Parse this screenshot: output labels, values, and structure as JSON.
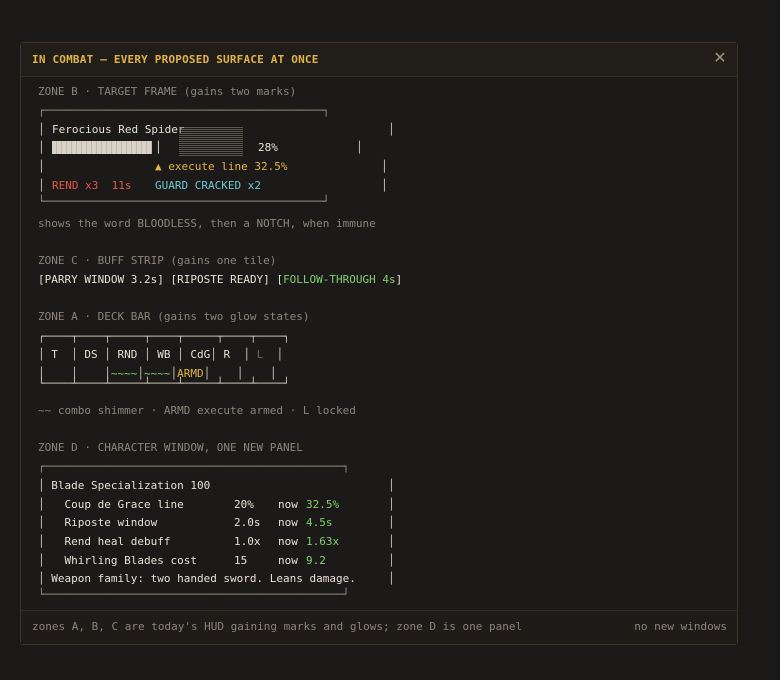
{
  "window": {
    "title": "IN COMBAT — EVERY PROPOSED SURFACE AT ONCE",
    "close_glyph": "✕"
  },
  "zone_b": {
    "heading": "ZONE B · TARGET FRAME (gains two marks)",
    "box_top": "┌────────────────────────────────────────────┐",
    "box_bottom": "└────────────────────────────────────────────┘",
    "target_name": "Ferocious Red Spider",
    "health_percent_label": "28%",
    "health_fraction": 0.28,
    "execute_label": "▲ execute line 32.5%",
    "debuff_label": "REND x3  11s",
    "guard_label": "GUARD CRACKED x2",
    "note": "shows the word BLOODLESS, then a NOTCH, when immune"
  },
  "zone_c": {
    "heading": "ZONE C · BUFF STRIP (gains one tile)",
    "tiles": [
      "[PARRY WINDOW 3.2s]",
      "[RIPOSTE READY]",
      "[",
      "FOLLOW-THROUGH 4s",
      "]"
    ]
  },
  "zone_a": {
    "heading": "ZONE A · DECK BAR (gains two glow states)",
    "row_top": "┌────┬────┬─────┬────┬─────┬────┬────┐",
    "row_mid_sep": "│    │    │~~~~~│~~~~│ARMD │    │    │",
    "row_bottom": "└────┴────┴─────┴────┴─────┴────┴────┘",
    "slots": [
      "T",
      "DS",
      "RND",
      "WB",
      "CdG",
      "R",
      "L"
    ],
    "shimmer": "~~~~",
    "armed": "ARMD",
    "legend": "~~ combo shimmer · ARMD execute armed · L locked"
  },
  "zone_d": {
    "heading": "ZONE D · CHARACTER WINDOW, ONE NEW PANEL",
    "box_top": "┌────────────────────────────────────────────┐",
    "box_bottom": "└────────────────────────────────────────────┘",
    "panel_title": "Blade Specialization 100",
    "rows": [
      {
        "label": "Coup de Grace line",
        "base": "20%",
        "now": "now",
        "value": "32.5%"
      },
      {
        "label": "Riposte window",
        "base": "2.0s",
        "now": "now",
        "value": "4.5s"
      },
      {
        "label": "Rend heal debuff",
        "base": "1.0x",
        "now": "now",
        "value": "1.63x"
      },
      {
        "label": "Whirling Blades cost",
        "base": "15",
        "now": "now",
        "value": "9.2"
      }
    ],
    "family_line": "Weapon family: two handed sword. Leans damage."
  },
  "footer": {
    "left": "zones A, B, C are today's HUD gaining marks and glows; zone D is one panel",
    "right": "no new windows"
  },
  "colors": {
    "accent": "#e0b34a",
    "debuff": "#e05a45",
    "guard": "#6cc7cf",
    "improved": "#7fcf6e"
  }
}
